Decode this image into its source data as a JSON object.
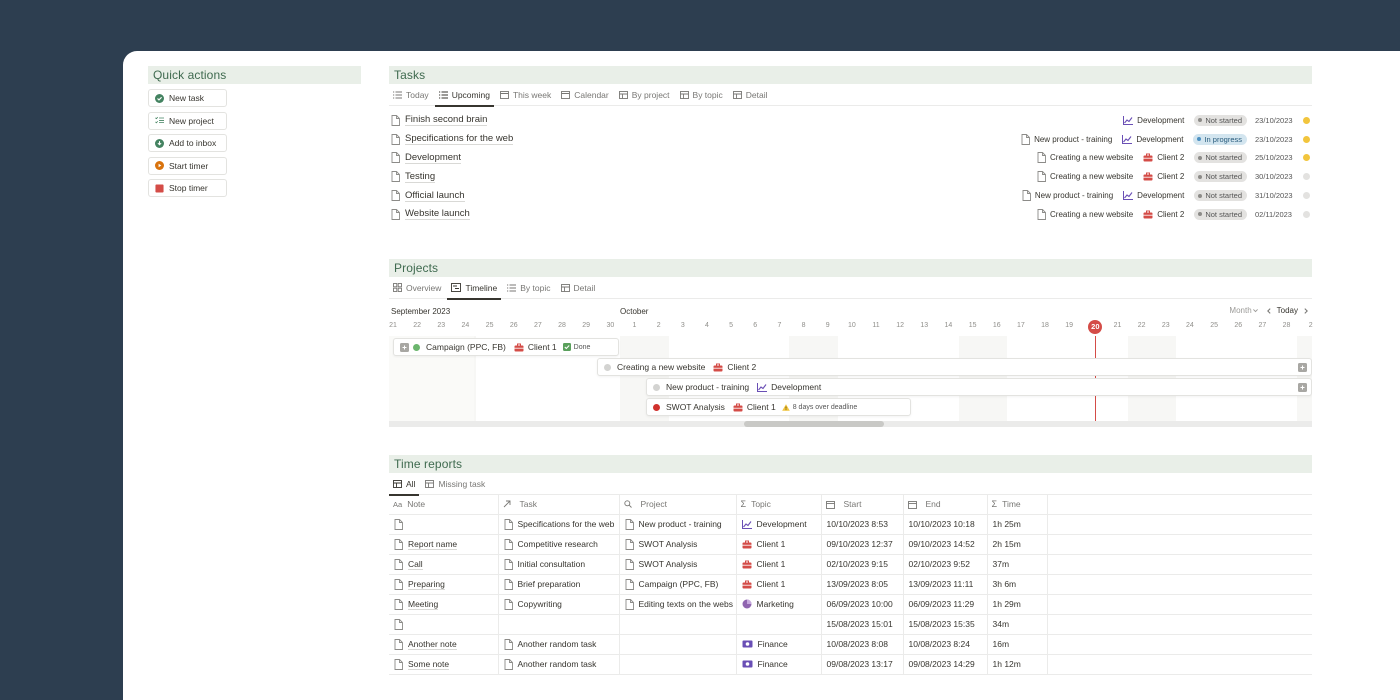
{
  "quick_actions": {
    "title": "Quick actions",
    "buttons": [
      {
        "label": "New task",
        "icon": "check-circle-icon",
        "color": "#448361"
      },
      {
        "label": "New project",
        "icon": "checklist-icon",
        "color": "#448361"
      },
      {
        "label": "Add to inbox",
        "icon": "download-circle-icon",
        "color": "#448361"
      },
      {
        "label": "Start timer",
        "icon": "play-circle-icon",
        "color": "#d9730d"
      },
      {
        "label": "Stop timer",
        "icon": "stop-square-icon",
        "color": "#d44c47"
      }
    ]
  },
  "tasks": {
    "title": "Tasks",
    "tabs": [
      "Today",
      "Upcoming",
      "This week",
      "Calendar",
      "By project",
      "By topic",
      "Detail"
    ],
    "active_tab": "Upcoming",
    "rows": [
      {
        "name": "Finish second brain",
        "project": "",
        "topic": "Development",
        "status": "Not started",
        "date": "23/10/2023",
        "priority": "#f2c53d"
      },
      {
        "name": "Specifications for the web",
        "project": "New product - training",
        "topic": "Development",
        "status": "In progress",
        "date": "23/10/2023",
        "priority": "#f2c53d"
      },
      {
        "name": "Development",
        "project": "Creating a new website",
        "topic": "Client 2",
        "status": "Not started",
        "date": "25/10/2023",
        "priority": "#f2c53d"
      },
      {
        "name": "Testing",
        "project": "Creating a new website",
        "topic": "Client 2",
        "status": "Not started",
        "date": "30/10/2023",
        "priority": "#e3e2e0"
      },
      {
        "name": "Official launch",
        "project": "New product - training",
        "topic": "Development",
        "status": "Not started",
        "date": "31/10/2023",
        "priority": "#e3e2e0"
      },
      {
        "name": "Website launch",
        "project": "Creating a new website",
        "topic": "Client 2",
        "status": "Not started",
        "date": "02/11/2023",
        "priority": "#e3e2e0"
      }
    ]
  },
  "projects": {
    "title": "Projects",
    "tabs": [
      "Overview",
      "Timeline",
      "By topic",
      "Detail"
    ],
    "active_tab": "Timeline",
    "months": [
      "September 2023",
      "October"
    ],
    "controls": {
      "scale": "Month",
      "today": "Today"
    },
    "days": [
      "21",
      "22",
      "23",
      "24",
      "25",
      "26",
      "27",
      "28",
      "29",
      "30",
      "1",
      "2",
      "3",
      "4",
      "5",
      "6",
      "7",
      "8",
      "9",
      "10",
      "11",
      "12",
      "13",
      "14",
      "15",
      "16",
      "17",
      "18",
      "19",
      "20",
      "21",
      "22",
      "23",
      "24",
      "25",
      "26",
      "27",
      "28",
      "2"
    ],
    "today_day": "20",
    "bars": [
      {
        "name": "Campaign (PPC, FB)",
        "topic": "Client 1",
        "badge": "Done",
        "status_color": "#6bb56d"
      },
      {
        "name": "Creating a new website",
        "topic": "Client 2",
        "badge": "",
        "status_color": "#d3d3d1"
      },
      {
        "name": "New product - training",
        "topic": "Development",
        "badge": "",
        "status_color": "#d3d3d1"
      },
      {
        "name": "SWOT Analysis",
        "topic": "Client 1",
        "badge": "8 days over deadline",
        "status_color": "#d0312d"
      }
    ]
  },
  "time_reports": {
    "title": "Time reports",
    "tabs": [
      "All",
      "Missing task"
    ],
    "active_tab": "All",
    "columns": [
      "Note",
      "Task",
      "Project",
      "Topic",
      "Start",
      "End",
      "Time"
    ],
    "rows": [
      {
        "note": "",
        "task": "Specifications for the web",
        "project": "New product - training",
        "topic": "Development",
        "topic_icon": "chart-icon",
        "start": "10/10/2023 8:53",
        "end": "10/10/2023 10:18",
        "time": "1h 25m"
      },
      {
        "note": "Report name",
        "task": "Competitive research",
        "project": "SWOT Analysis",
        "topic": "Client 1",
        "topic_icon": "briefcase-icon",
        "start": "09/10/2023 12:37",
        "end": "09/10/2023 14:52",
        "time": "2h 15m"
      },
      {
        "note": "Call",
        "task": "Initial consultation",
        "project": "SWOT Analysis",
        "topic": "Client 1",
        "topic_icon": "briefcase-icon",
        "start": "02/10/2023 9:15",
        "end": "02/10/2023 9:52",
        "time": "37m"
      },
      {
        "note": "Preparing",
        "task": "Brief preparation",
        "project": "Campaign (PPC, FB)",
        "topic": "Client 1",
        "topic_icon": "briefcase-icon",
        "start": "13/09/2023 8:05",
        "end": "13/09/2023 11:11",
        "time": "3h 6m"
      },
      {
        "note": "Meeting",
        "task": "Copywriting",
        "project": "Editing texts on the webs",
        "topic": "Marketing",
        "topic_icon": "pie-icon",
        "start": "06/09/2023 10:00",
        "end": "06/09/2023 11:29",
        "time": "1h 29m"
      },
      {
        "note": "",
        "task": "",
        "project": "",
        "topic": "",
        "topic_icon": "",
        "start": "15/08/2023 15:01",
        "end": "15/08/2023 15:35",
        "time": "34m"
      },
      {
        "note": "Another note",
        "task": "Another random task",
        "project": "",
        "topic": "Finance",
        "topic_icon": "money-icon",
        "start": "10/08/2023 8:08",
        "end": "10/08/2023 8:24",
        "time": "16m"
      },
      {
        "note": "Some note",
        "task": "Another random task",
        "project": "",
        "topic": "Finance",
        "topic_icon": "money-icon",
        "start": "09/08/2023 13:17",
        "end": "09/08/2023 14:29",
        "time": "1h 12m"
      }
    ]
  }
}
